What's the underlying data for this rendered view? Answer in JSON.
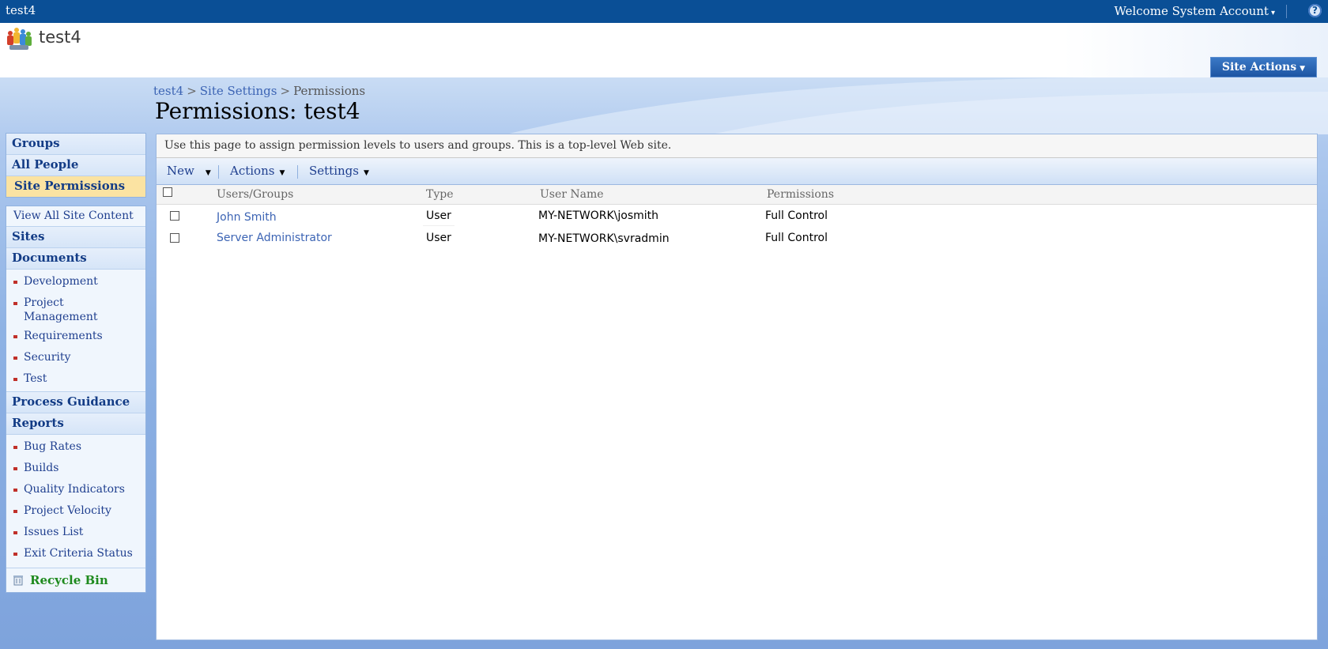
{
  "topbar": {
    "site_name": "test4",
    "welcome": "Welcome System Account",
    "help_glyph": "?"
  },
  "header": {
    "site_title": "test4",
    "site_actions": "Site Actions"
  },
  "breadcrumb": {
    "items": [
      "test4",
      "Site Settings",
      "Permissions"
    ],
    "separator": ">"
  },
  "page": {
    "title": "Permissions: test4",
    "description": "Use this page to assign permission levels to users and groups. This is a top-level Web site."
  },
  "nav": {
    "top": [
      {
        "label": "Groups",
        "selected": false
      },
      {
        "label": "All People",
        "selected": false
      },
      {
        "label": "Site Permissions",
        "selected": true
      }
    ],
    "view_all": "View All Site Content",
    "sites": "Sites",
    "documents": {
      "label": "Documents",
      "items": [
        "Development",
        "Project Management",
        "Requirements",
        "Security",
        "Test"
      ]
    },
    "process_guidance": "Process Guidance",
    "reports": {
      "label": "Reports",
      "items": [
        "Bug Rates",
        "Builds",
        "Quality Indicators",
        "Project Velocity",
        "Issues List",
        "Exit Criteria Status"
      ]
    },
    "recycle_bin": "Recycle Bin"
  },
  "toolbar": {
    "new": "New",
    "actions": "Actions",
    "settings": "Settings"
  },
  "table": {
    "columns": [
      "Users/Groups",
      "Type",
      "User Name",
      "Permissions"
    ],
    "rows": [
      {
        "name": "John Smith",
        "type": "User",
        "username": "MY-NETWORK\\josmith",
        "permissions": "Full Control"
      },
      {
        "name": "Server Administrator",
        "type": "User",
        "username": "MY-NETWORK\\svradmin",
        "permissions": "Full Control"
      }
    ]
  },
  "colors": {
    "topbar": "#0a4f96",
    "link": "#3c64b4",
    "nav_heading": "#133c86",
    "selected_nav": "#fbe3a2",
    "bullet": "#c0302a",
    "recycle": "#1e8a1e"
  }
}
